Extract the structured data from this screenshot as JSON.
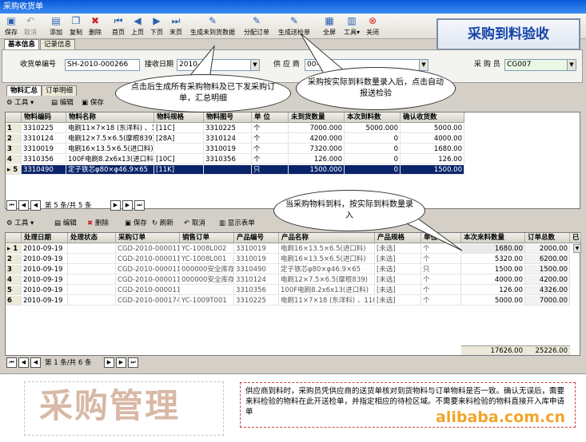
{
  "window": {
    "title": "采购收货单"
  },
  "toolbar": {
    "save": "保存",
    "cancel": "取消",
    "add": "添加",
    "copy": "复制",
    "delete": "删除",
    "first": "首页",
    "prev": "上页",
    "next": "下页",
    "last": "末页",
    "gen_summary": "生成未到货数据",
    "allocate": "分配订单",
    "gen_inspection": "生成送检单",
    "fullscreen": "全屏",
    "tools": "工具",
    "close": "关闭"
  },
  "banner": "采购到料验收",
  "tabs": {
    "basic": "基本信息",
    "records": "记录信息"
  },
  "form": {
    "receipt_no_label": "收货单编号",
    "receipt_no": "SH-2010-000266",
    "date_label": "接收日期",
    "date": "2010-08-",
    "supplier_label": "供 应 商",
    "supplier": "00-36",
    "buyer_label": "采 购 员",
    "buyer": "CG007"
  },
  "subtabs": {
    "summary": "物料汇总",
    "detail": "订单明细"
  },
  "upper_toolbar": {
    "tools": "工具",
    "edit": "编辑",
    "save": "保存"
  },
  "upper_grid": {
    "headers": [
      "物料编码",
      "物料名称",
      "物料规格",
      "物料图号",
      "单 位",
      "未到货数量",
      "本次到料数",
      "确认收货数"
    ],
    "rows": [
      {
        "idx": "1",
        "code": "3310225",
        "name": "电刷11×7×18 (东洋料) 、110B",
        "spec": "[11C]",
        "drawing": "3310225",
        "unit": "个",
        "pending": "7000.000",
        "arrived": "5000.000",
        "confirmed": "5000.00"
      },
      {
        "idx": "2",
        "code": "3310124",
        "name": "电刷12×7.5×6.5(摩根839)",
        "spec": "[28A]",
        "drawing": "3310124",
        "unit": "个",
        "pending": "4200.000",
        "arrived": "0",
        "confirmed": "4000.00"
      },
      {
        "idx": "3",
        "code": "3310019",
        "name": "电刷16×13.5×6.5(进口料)",
        "spec": "",
        "drawing": "3310019",
        "unit": "个",
        "pending": "7320.000",
        "arrived": "0",
        "confirmed": "1680.00"
      },
      {
        "idx": "4",
        "code": "3310356",
        "name": "100F电刷8.2x6x13(进口料)",
        "spec": "[10C]",
        "drawing": "3310356",
        "unit": "个",
        "pending": "126.000",
        "arrived": "0",
        "confirmed": "126.00"
      },
      {
        "idx": "▸ 5",
        "code": "3310490",
        "name": "定子铁芯φ80×φ46.9×65",
        "spec": "[11K]",
        "drawing": "",
        "unit": "只",
        "pending": "1500.000",
        "arrived": "0",
        "confirmed": "1500.00"
      }
    ],
    "pager": "第 5 条/共 5 条"
  },
  "lower_toolbar": {
    "tools": "工具",
    "edit": "编辑",
    "delete": "删除",
    "save": "保存",
    "refresh": "刷新",
    "cancel": "取消",
    "show_form": "显示表单"
  },
  "lower_grid": {
    "headers": [
      "处理日期",
      "处理状态",
      "采购订单",
      "销售订单",
      "产品编号",
      "产品名称",
      "产品规格",
      "单位",
      "本次来料数量",
      "订单总数",
      "已"
    ],
    "rows": [
      {
        "idx": "▸ 1",
        "date": "2010-09-19",
        "status": "",
        "po": "CGD-2010-000011",
        "so": "YC-1008L002",
        "pcode": "3310019",
        "pname": "电刷16×13.5×6.5(进口料)",
        "spec": "[未选]",
        "unit": "个",
        "qty": "1680.00",
        "total": "2000.00"
      },
      {
        "idx": "2",
        "date": "2010-09-19",
        "status": "",
        "po": "CGD-2010-000011",
        "so": "YC-1008L001",
        "pcode": "3310019",
        "pname": "电刷16×13.5×6.5(进口料)",
        "spec": "[未选]",
        "unit": "个",
        "qty": "5320.00",
        "total": "6200.00"
      },
      {
        "idx": "3",
        "date": "2010-09-19",
        "status": "",
        "po": "CGD-2010-000011",
        "so": "000000安全库存",
        "pcode": "3310490",
        "pname": "定子铁芯φ80×φ46.9×65",
        "spec": "[未选]",
        "unit": "只",
        "qty": "1500.00",
        "total": "1500.00"
      },
      {
        "idx": "4",
        "date": "2010-09-19",
        "status": "",
        "po": "CGD-2010-000011",
        "so": "000000安全库存",
        "pcode": "3310124",
        "pname": "电刷12×7.5×6.5(摩根839)",
        "spec": "[未选]",
        "unit": "个",
        "qty": "4000.00",
        "total": "4200.00"
      },
      {
        "idx": "5",
        "date": "2010-09-19",
        "status": "",
        "po": "CGD-2010-000011",
        "so": "",
        "pcode": "3310356",
        "pname": "100F电刷8.2x6x13(进口料)",
        "spec": "[未选]",
        "unit": "个",
        "qty": "126.00",
        "total": "4326.00"
      },
      {
        "idx": "6",
        "date": "2010-09-19",
        "status": "",
        "po": "CGD-2010-000174",
        "so": "YC-1009T001",
        "pcode": "3310225",
        "pname": "电刷11×7×18 (东洋料) 、110B",
        "spec": "[未选]",
        "unit": "个",
        "qty": "5000.00",
        "total": "7000.00"
      }
    ],
    "sum_qty": "17626.00",
    "sum_total": "25226.00",
    "pager": "第 1 条/共 6 条"
  },
  "callouts": {
    "c1": "点击后生成所有采购物料及已下发采购订单，汇总明细",
    "c2": "采购按实际到料数量录入后，点击自动报送检验",
    "c3": "当采购物料到料，按实际到料数量录入"
  },
  "footer": {
    "logo": "采购管理",
    "note": "供应商到料时，采购员凭供应商的送货单核对到货物料与订单物料是否一致。确认无误后，需要来料检验的物料在此开送检单，并指定相应的待检区域。不需要来料检验的物料直接开入库申请单",
    "watermark": "alibaba.com.cn"
  }
}
